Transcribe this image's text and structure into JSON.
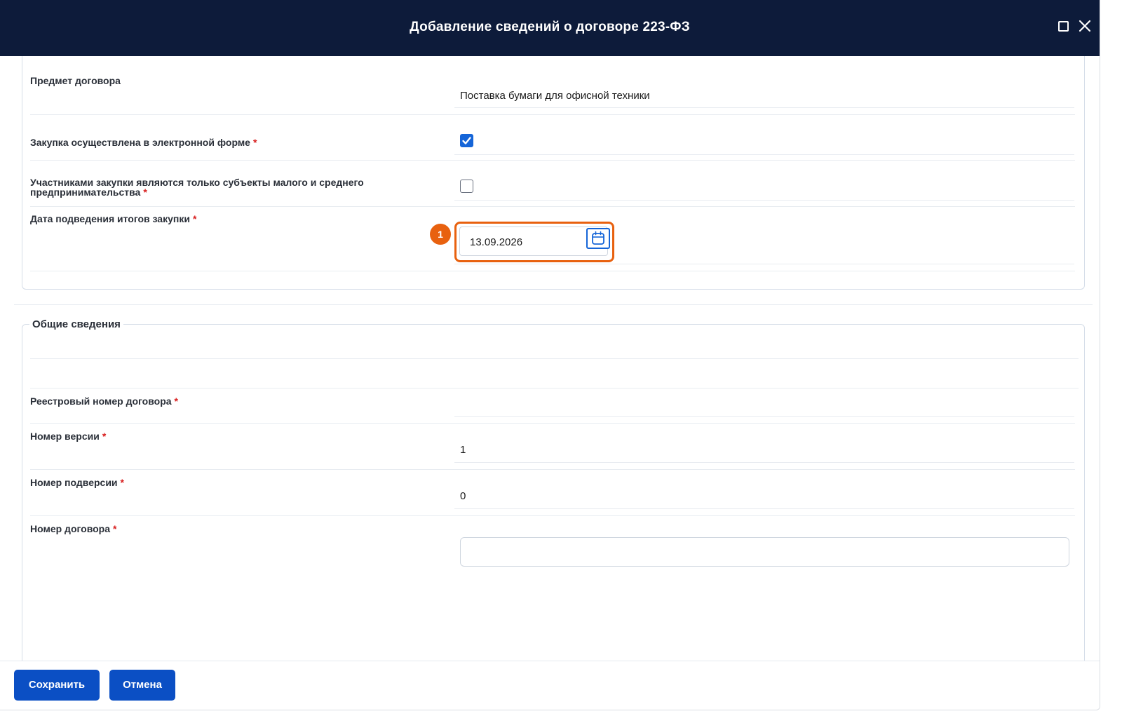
{
  "dialog": {
    "title": "Добавление сведений о договоре 223-ФЗ"
  },
  "section_contract": {
    "subject_label": "Предмет договора",
    "subject_value": "Поставка бумаги для офисной техники",
    "electronic_label": "Закупка осуществлена в электронной форме",
    "electronic_checked": true,
    "sme_label_line1": "Участниками закупки являются только субъекты малого и среднего",
    "sme_label_line2": "предпринимательства",
    "sme_checked": false,
    "summary_date_label": "Дата подведения итогов закупки",
    "summary_date_value": "13.09.2026",
    "callout_number": "1",
    "required_mark": "*"
  },
  "section_general": {
    "legend": "Общие сведения",
    "registry_number_label": "Реестровый номер договора",
    "registry_number_value": "",
    "version_label": "Номер версии",
    "version_value": "1",
    "subversion_label": "Номер подверсии",
    "subversion_value": "0",
    "contract_number_label": "Номер договора",
    "contract_number_value": ""
  },
  "footer": {
    "save_label": "Сохранить",
    "cancel_label": "Отмена"
  },
  "colors": {
    "titlebar": "#0d1b3a",
    "primary": "#0b4fc4",
    "highlight": "#e8610f",
    "required": "#d81e1e"
  }
}
